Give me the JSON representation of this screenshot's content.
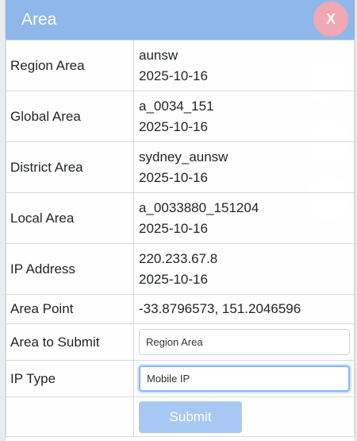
{
  "dialog": {
    "title": "Area",
    "close_label": "X"
  },
  "rows": [
    {
      "label": "Region Area",
      "value": "aunsw",
      "date": "2025-10-16"
    },
    {
      "label": "Global Area",
      "value": "a_0034_151",
      "date": "2025-10-16"
    },
    {
      "label": "District Area",
      "value": "sydney_aunsw",
      "date": "2025-10-16"
    },
    {
      "label": "Local Area",
      "value": "a_0033880_151204",
      "date": "2025-10-16"
    },
    {
      "label": "IP Address",
      "value": "220.233.67.8",
      "date": "2025-10-16"
    }
  ],
  "area_point": {
    "label": "Area Point",
    "value": "-33.8796573, 151.2046596"
  },
  "area_to_submit": {
    "label": "Area to Submit",
    "value": "Region Area"
  },
  "ip_type": {
    "label": "IP Type",
    "value": "Mobile IP"
  },
  "submit": {
    "label": "Submit"
  },
  "colors": {
    "header": "#8fb8ea",
    "close_button": "#f0a8b4",
    "submit_button": "#a8c8f4"
  }
}
